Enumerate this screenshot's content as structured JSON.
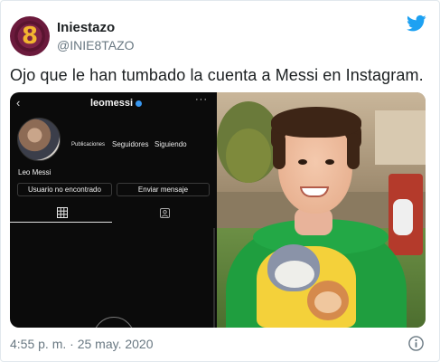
{
  "tweet": {
    "display_name": "Iniestazo",
    "handle": "@INIE8TAZO",
    "avatar_letter": "8",
    "text": "Ojo que le han tumbado la cuenta a Messi en Instagram.",
    "timestamp": "4:55 p. m. · 25 may. 2020"
  },
  "instagram": {
    "back_glyph": "‹",
    "username": "leomessi",
    "more_glyph": "···",
    "stats": {
      "posts_label": "Publicaciones",
      "followers_label": "Seguidores",
      "following_label": "Siguiendo"
    },
    "profile_name": "Leo Messi",
    "buttons": {
      "user_not_found": "Usuario no encontrado",
      "send_message": "Enviar mensaje"
    }
  },
  "colors": {
    "twitter_blue": "#1da1f2",
    "text_dark": "#1c2022",
    "text_gray": "#697882",
    "verified_blue": "#3897f0"
  },
  "icons": [
    "twitter-bird-icon",
    "grid-icon",
    "tagged-icon",
    "info-icon",
    "verified-badge-icon"
  ]
}
